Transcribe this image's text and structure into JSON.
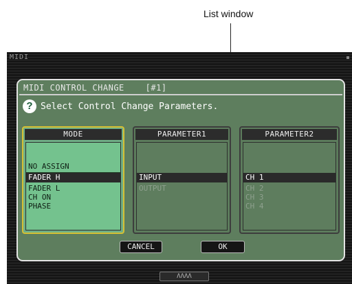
{
  "annotation": {
    "label": "List window"
  },
  "window": {
    "title": "MIDI",
    "bottom_label": "ΛΛΛΛ"
  },
  "dialog": {
    "title": "MIDI CONTROL CHANGE    [#1]",
    "help_glyph": "?",
    "prompt": "Select Control Change Parameters.",
    "columns": {
      "mode": {
        "header": "MODE",
        "items": [
          "",
          "NO ASSIGN",
          "FADER H",
          "FADER L",
          "CH ON",
          "PHASE"
        ],
        "selected": "FADER H"
      },
      "parameter1": {
        "header": "PARAMETER1",
        "items": [
          "INPUT",
          "OUTPUT"
        ],
        "selected": "INPUT"
      },
      "parameter2": {
        "header": "PARAMETER2",
        "items": [
          "CH 1",
          "CH 2",
          "CH 3",
          "CH 4"
        ],
        "selected": "CH 1"
      }
    },
    "buttons": {
      "cancel": "CANCEL",
      "ok": "OK"
    }
  },
  "colors": {
    "dialog_bg": "#5e7e5e",
    "list_active_bg": "#74c28e",
    "focus_border": "#d6c033",
    "selected_row_bg": "#2a2a2a"
  }
}
